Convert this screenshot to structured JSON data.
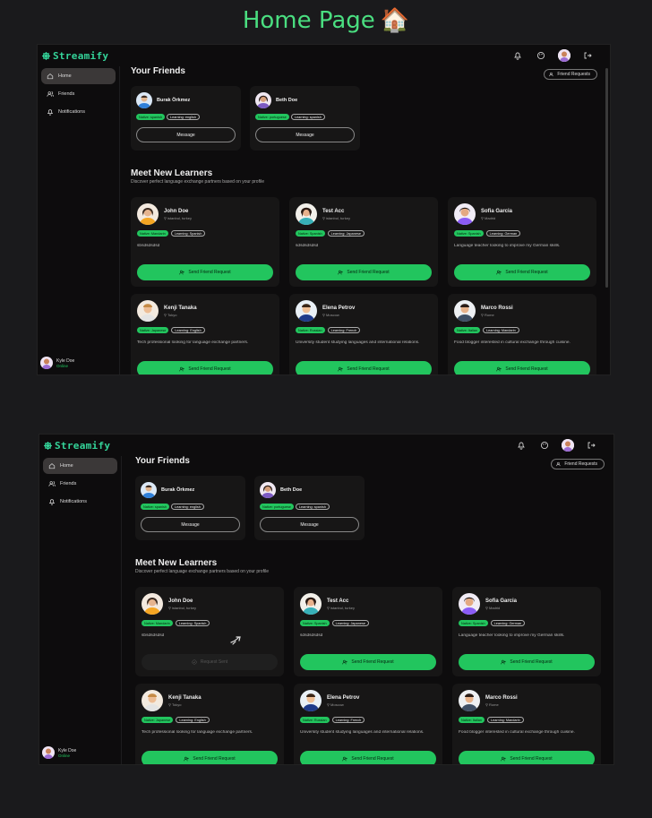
{
  "page_title": "Home Page",
  "app": {
    "logo": "Streamify",
    "nav": [
      {
        "label": "Home",
        "icon": "home-icon"
      },
      {
        "label": "Friends",
        "icon": "users-icon"
      },
      {
        "label": "Notifications",
        "icon": "bell-icon"
      }
    ],
    "user": {
      "name": "Kyle Doe",
      "status": "Online"
    },
    "top_icons": [
      "bell-icon",
      "palette-icon",
      "avatar",
      "logout-icon"
    ]
  },
  "friends": {
    "title": "Your Friends",
    "requests_button": "Friend Requests",
    "message_label": "Message",
    "items": [
      {
        "name": "Burak Örkmez",
        "native": "Native: spanish",
        "learning": "Learning: english"
      },
      {
        "name": "Beth Doe",
        "native": "Native: portuguese",
        "learning": "Learning: spanish"
      }
    ]
  },
  "learners": {
    "title": "Meet New Learners",
    "subtitle": "Discover perfect language exchange partners based on your profile",
    "send_label": "Send Friend Request",
    "sent_label": "Request Sent",
    "items": [
      {
        "name": "John Doe",
        "location": "istanbul, turkey",
        "native": "Native: Mandarin",
        "learning": "Learning: Spanish",
        "bio": "sbsdsdsdsd"
      },
      {
        "name": "Test Acc",
        "location": "istanbul, turkey",
        "native": "Native: Spanish",
        "learning": "Learning: Japanese",
        "bio": "sdsdsdsdsd"
      },
      {
        "name": "Sofia Garcia",
        "location": "Madrid",
        "native": "Native: Spanish",
        "learning": "Learning: German",
        "bio": "Language teacher looking to improve my German skills."
      },
      {
        "name": "Kenji Tanaka",
        "location": "Tokyo",
        "native": "Native: Japanese",
        "learning": "Learning: English",
        "bio": "Tech professional looking for language exchange partners."
      },
      {
        "name": "Elena Petrov",
        "location": "Moscow",
        "native": "Native: Russian",
        "learning": "Learning: French",
        "bio": "University student studying languages and international relations."
      },
      {
        "name": "Marco Rossi",
        "location": "Rome",
        "native": "Native: Italian",
        "learning": "Learning: Mandarin",
        "bio": "Food blogger interested in cultural exchange through cuisine."
      }
    ]
  },
  "colors": {
    "accent": "#22c55e",
    "logo": "#34d399",
    "title": "#4ade80",
    "background": "#0d0c0d"
  }
}
